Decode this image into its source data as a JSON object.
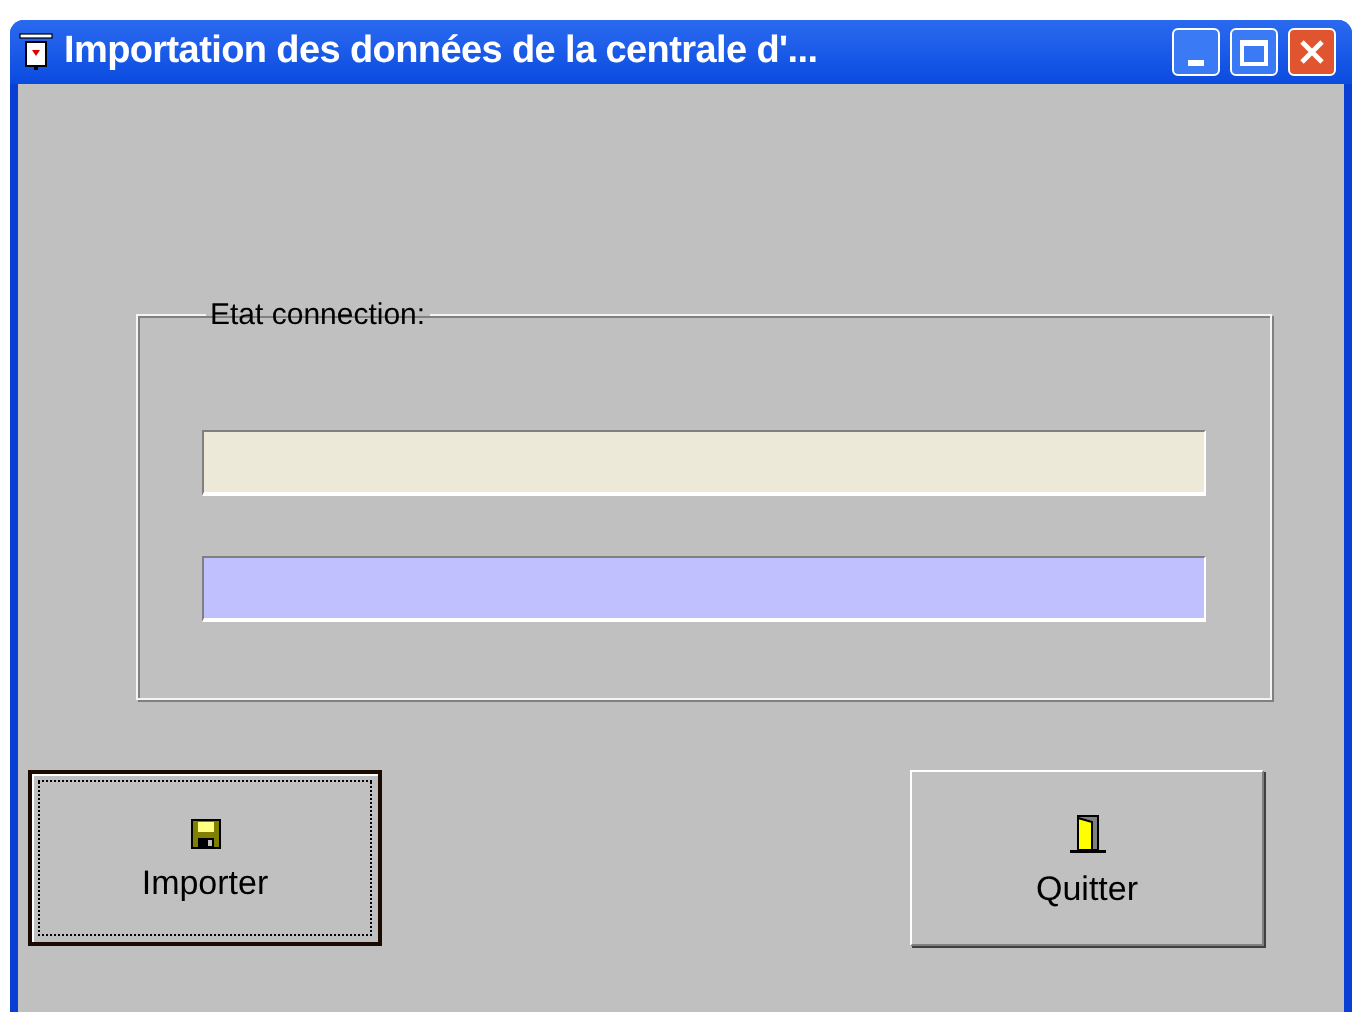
{
  "window": {
    "title": "Importation des données de la centrale d'..."
  },
  "group": {
    "label": "Etat connection:",
    "bars": [
      {
        "color": "#ece9d8"
      },
      {
        "color": "#c0c0ff"
      }
    ]
  },
  "buttons": [
    {
      "label": "Importer",
      "kind": "save",
      "focused": true
    },
    {
      "label": "Quitter",
      "kind": "exit",
      "focused": false
    }
  ]
}
